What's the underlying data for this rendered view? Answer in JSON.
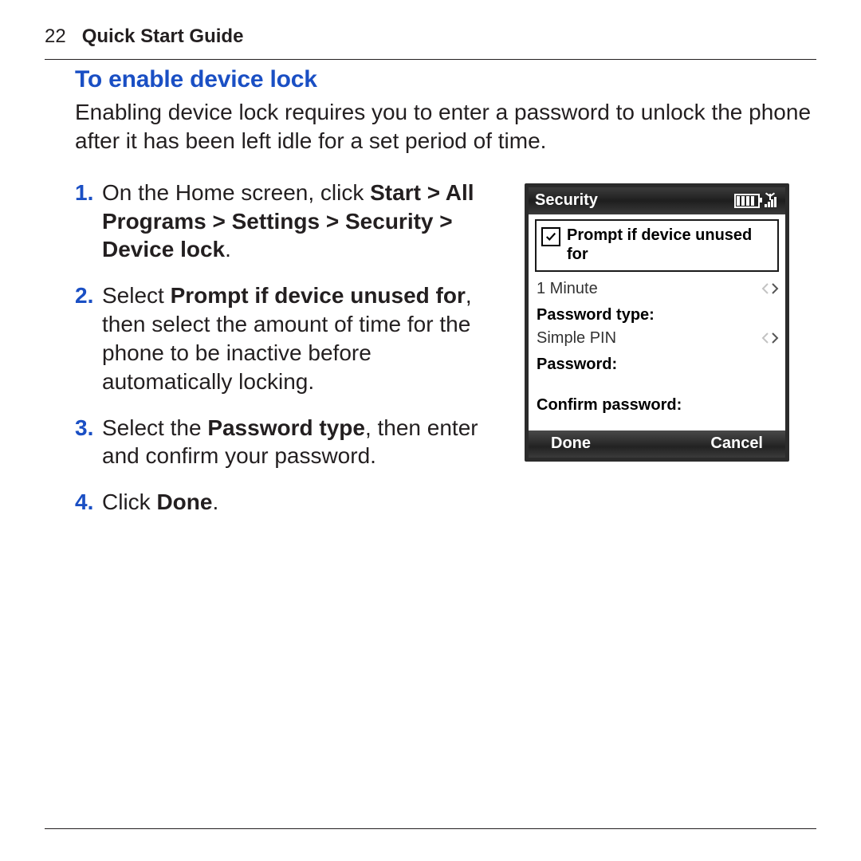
{
  "header": {
    "page_number": "22",
    "running_title": "Quick Start Guide"
  },
  "section": {
    "title": "To enable device lock",
    "intro": "Enabling device lock requires you to enter a password to unlock the phone after it has been left idle for a set period of time."
  },
  "steps": [
    {
      "num": "1.",
      "pre": "On the Home screen, click ",
      "bold1": "Start > All Programs > Settings > Security > Device lock",
      "post1": "."
    },
    {
      "num": "2.",
      "pre": "Select ",
      "bold1": "Prompt if device unused for",
      "mid": ", then select the amount of time for the phone to be inactive before automatically locking."
    },
    {
      "num": "3.",
      "pre": "Select the ",
      "bold1": "Password type",
      "mid": ", then enter and confirm your password."
    },
    {
      "num": "4.",
      "pre": "Click ",
      "bold1": "Done",
      "post1": "."
    }
  ],
  "phone": {
    "title": "Security",
    "prompt_label": "Prompt if device unused for",
    "time_value": "1 Minute",
    "password_type_label": "Password type:",
    "password_type_value": "Simple PIN",
    "password_label": "Password:",
    "confirm_label": "Confirm password:",
    "softkey_left": "Done",
    "softkey_right": "Cancel"
  }
}
